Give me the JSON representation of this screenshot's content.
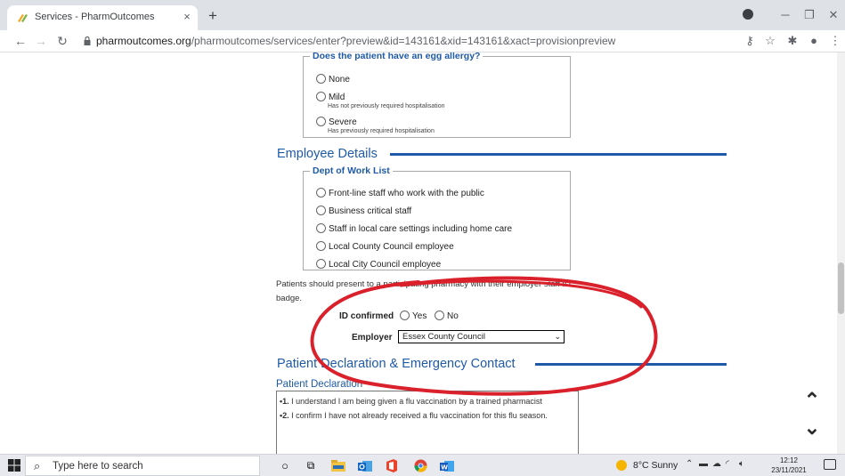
{
  "browser": {
    "tab_title": "Services - PharmOutcomes",
    "tab_close": "×",
    "new_tab": "+",
    "url_host": "pharmoutcomes.org",
    "url_path": "/pharmoutcomes/services/enter?preview&id=143161&xid=143161&xact=provisionpreview"
  },
  "egg_allergy": {
    "legend": "Does the patient have an egg allergy?",
    "options": [
      {
        "label": "None",
        "note": ""
      },
      {
        "label": "Mild",
        "note": "Has not previously required hospitalisation"
      },
      {
        "label": "Severe",
        "note": "Has previously required hospitalisation"
      }
    ]
  },
  "employee_details": {
    "heading": "Employee Details",
    "dept_legend": "Dept of Work List",
    "dept_options": [
      "Front-line staff who work with the public",
      "Business critical staff",
      "Staff in local care settings including home care",
      "Local County Council employee",
      "Local City Council employee"
    ],
    "paragraph": "Patients should present to a participating pharmacy with their employer staff ID badge.",
    "id_confirmed_label": "ID confirmed",
    "id_yes": "Yes",
    "id_no": "No",
    "employer_label": "Employer",
    "employer_value": "Essex County Council"
  },
  "declaration": {
    "heading": "Patient Declaration & Emergency Contact",
    "subheading": "Patient Declaration",
    "items": [
      {
        "num": "•1.",
        "text": " I understand I am being given a flu vaccination by a trained pharmacist"
      },
      {
        "num": "•2.",
        "text": " I confirm I have not already received a flu vaccination for this flu season."
      }
    ]
  },
  "taskbar": {
    "search_placeholder": "Type here to search",
    "weather": "8°C  Sunny",
    "time": "12:12",
    "date": "23/11/2021"
  },
  "colors": {
    "accent_blue": "#1f5aa8",
    "annotation_red": "#d9202b"
  }
}
